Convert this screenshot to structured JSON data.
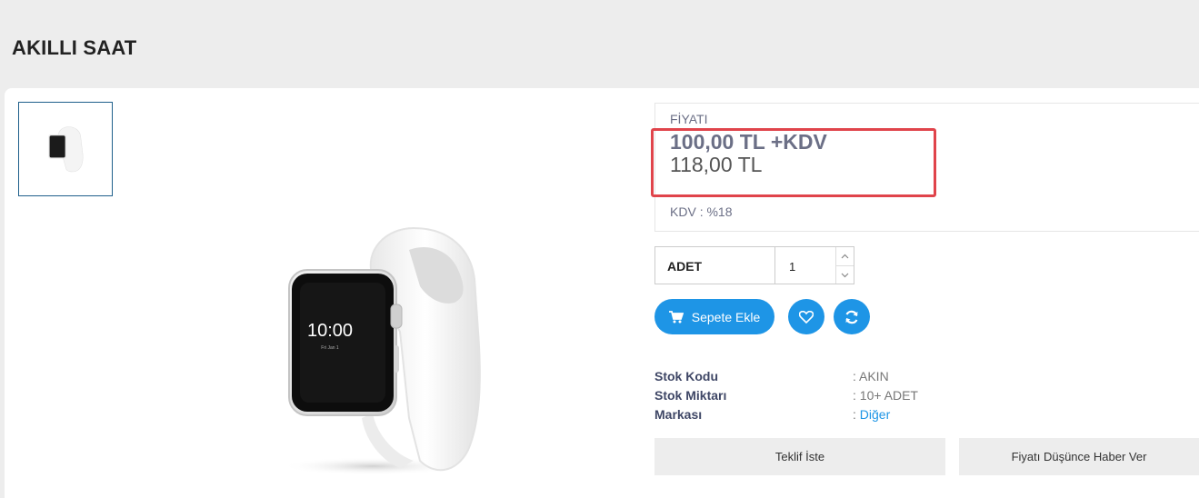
{
  "page": {
    "title": "AKILLI SAAT"
  },
  "product": {
    "watch_time": "10:00",
    "watch_date": "Fri Jan 1"
  },
  "price": {
    "label": "FİYATI",
    "amount": "100,00 TL",
    "tax_suffix": "+KDV",
    "total": "118,00 TL",
    "kdv_label": "KDV",
    "kdv_separator": ":",
    "kdv_value": "%18"
  },
  "quantity": {
    "label": "ADET",
    "value": "1"
  },
  "buttons": {
    "add_to_cart": "Sepete Ekle"
  },
  "specs": [
    {
      "key": "Stok Kodu",
      "value": ": AKIN"
    },
    {
      "key": "Stok Miktarı",
      "value": ": 10+ ADET"
    },
    {
      "key": "Markası",
      "value_prefix": ": ",
      "value": "Diğer"
    }
  ],
  "actions": {
    "request_quote": "Teklif İste",
    "price_alert": "Fiyatı Düşünce Haber Ver"
  },
  "colors": {
    "accent": "#1e95e6",
    "highlight": "#e0444b",
    "label": "#6b6f86"
  },
  "icons": [
    "cart-icon",
    "heart-icon",
    "refresh-icon",
    "chevron-up-icon",
    "chevron-down-icon"
  ]
}
